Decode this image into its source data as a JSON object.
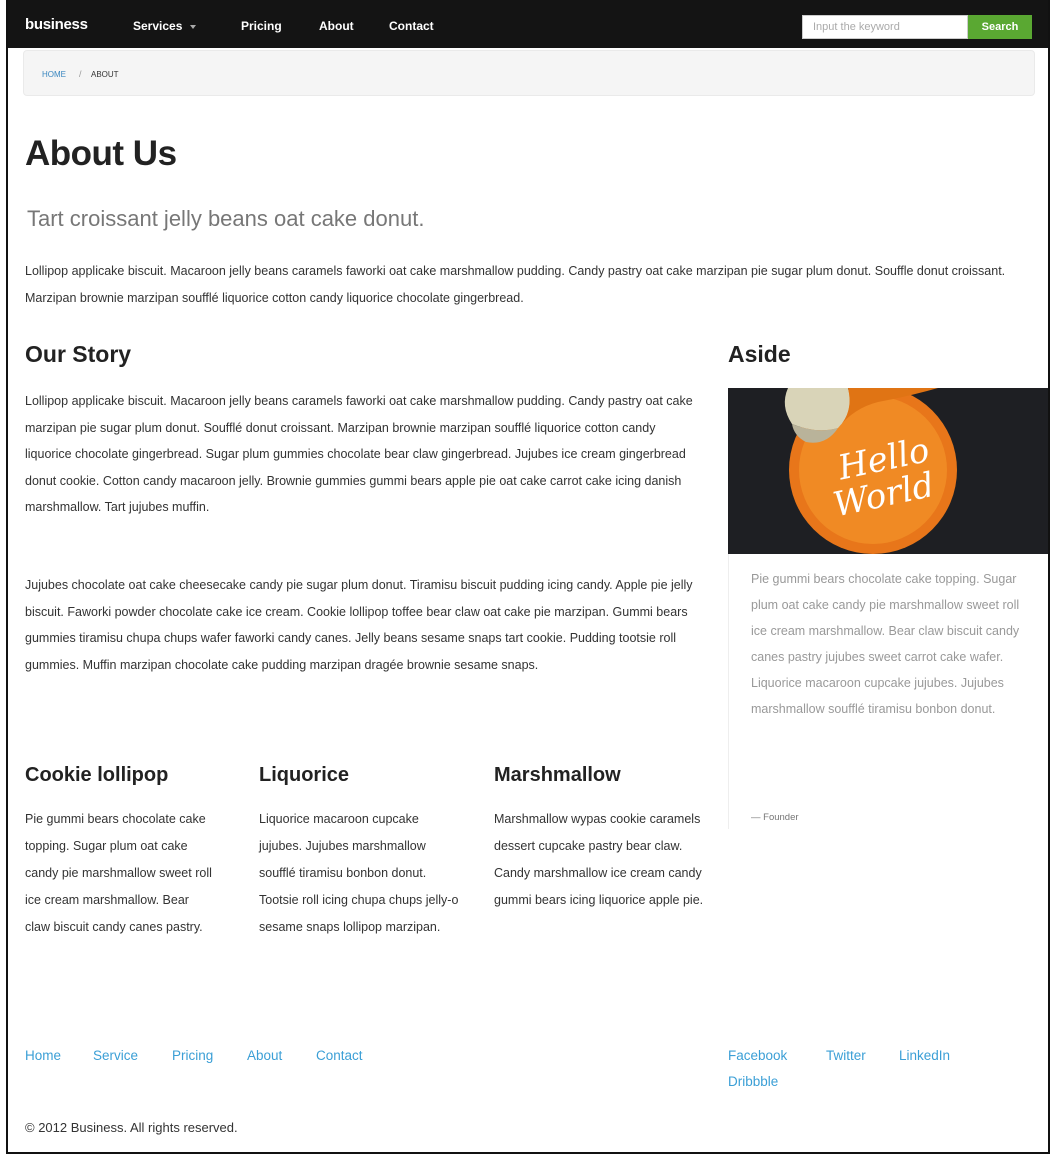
{
  "navbar": {
    "brand": "business",
    "items": [
      {
        "label": "Services"
      },
      {
        "label": "Pricing"
      },
      {
        "label": "About"
      },
      {
        "label": "Contact"
      }
    ],
    "search_placeholder": "Input the keyword",
    "search_button": "Search",
    "search_button_color": "#5aa832"
  },
  "breadcrumb": {
    "home": "Home",
    "separator": "/",
    "current": "About"
  },
  "page": {
    "title": "About Us",
    "lead": "Tart croissant jelly beans oat cake donut.",
    "intro": "Lollipop applicake biscuit. Macaroon jelly beans caramels faworki oat cake marshmallow pudding. Candy pastry oat cake marzipan pie sugar plum donut. Souffle donut croissant. Marzipan brownie marzipan soufflé liquorice cotton candy liquorice chocolate gingerbread."
  },
  "story": {
    "title": "Our Story",
    "paragraphs": [
      "Lollipop applicake biscuit. Macaroon jelly beans caramels faworki oat cake marshmallow pudding. Candy pastry oat cake marzipan pie sugar plum donut. Soufflé donut croissant. Marzipan brownie marzipan soufflé liquorice cotton candy liquorice chocolate gingerbread. Sugar plum gummies chocolate bear claw gingerbread. Jujubes ice cream gingerbread donut cookie. Cotton candy macaroon jelly. Brownie gummies gummi bears apple pie oat cake carrot cake icing danish marshmallow. Tart jujubes muffin.",
      "Jujubes chocolate oat cake cheesecake candy pie sugar plum donut. Tiramisu biscuit pudding icing candy. Apple pie jelly biscuit. Faworki powder chocolate cake ice cream. Cookie lollipop toffee bear claw oat cake pie marzipan. Gummi bears gummies tiramisu chupa chups wafer faworki candy canes. Jelly beans sesame snaps tart cookie. Pudding tootsie roll gummies. Muffin marzipan chocolate cake pudding marzipan dragée brownie sesame snaps."
    ]
  },
  "columns": [
    {
      "title": "Cookie lollipop",
      "text": "Pie gummi bears chocolate cake topping. Sugar plum oat cake candy pie marshmallow sweet roll ice cream marshmallow. Bear claw biscuit candy canes pastry."
    },
    {
      "title": "Liquorice",
      "text": "Liquorice macaroon cupcake jujubes. Jujubes marshmallow soufflé tiramisu bonbon donut. Tootsie roll icing chupa chups jelly-o sesame snaps lollipop marzipan."
    },
    {
      "title": "Marshmallow",
      "text": "Marshmallow wypas cookie caramels dessert cupcake pastry bear claw. Candy marshmallow ice cream candy gummi bears icing liquorice apple pie."
    }
  ],
  "aside": {
    "title": "Aside",
    "sticker_line1": "Hello",
    "sticker_line2": "World",
    "quote": "Pie gummi bears chocolate cake topping. Sugar plum oat cake candy pie marshmallow sweet roll ice cream marshmallow. Bear claw biscuit candy canes pastry jujubes sweet carrot cake wafer. Liquorice macaroon cupcake jujubes. Jujubes marshmallow soufflé tiramisu bonbon donut.",
    "source": "— Founder"
  },
  "footer": {
    "links": [
      "Home",
      "Service",
      "Pricing",
      "About",
      "Contact"
    ],
    "social": [
      "Facebook",
      "Twitter",
      "LinkedIn",
      "Dribbble"
    ],
    "copyright": "© 2012 Business. All rights reserved.",
    "link_color": "#3b9fd6"
  }
}
